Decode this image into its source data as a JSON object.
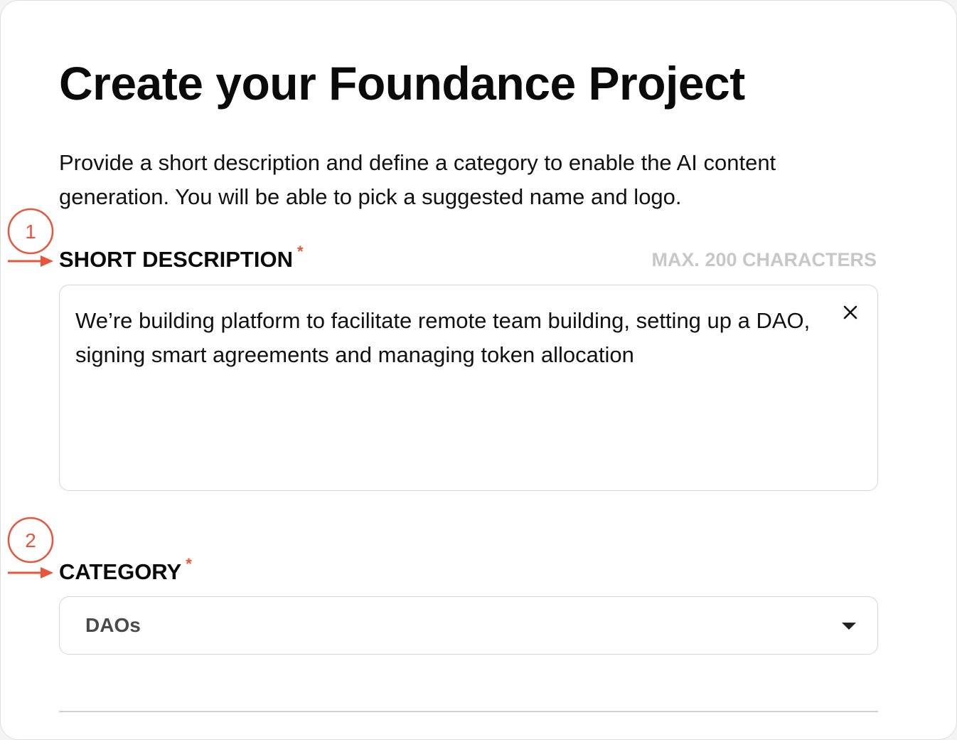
{
  "page": {
    "title": "Create your Foundance Project",
    "intro": "Provide a short description and define a category to enable the AI content generation. You will be able to pick a suggested name and logo."
  },
  "description_field": {
    "label": "SHORT DESCRIPTION",
    "required_mark": "*",
    "hint": "MAX. 200 CHARACTERS",
    "value": "We’re building platform to facilitate remote team building, setting up a DAO, signing smart agreements and managing token allocation",
    "clear_icon": "close-icon"
  },
  "category_field": {
    "label": "CATEGORY",
    "required_mark": "*",
    "selected": "DAOs",
    "dropdown_icon": "caret-down-icon"
  },
  "annotations": {
    "step1": "1",
    "step2": "2"
  },
  "colors": {
    "accent": "#e8553a",
    "hint": "#c7c7c7",
    "border": "#d6d6d6",
    "text": "#0a0a0a"
  }
}
